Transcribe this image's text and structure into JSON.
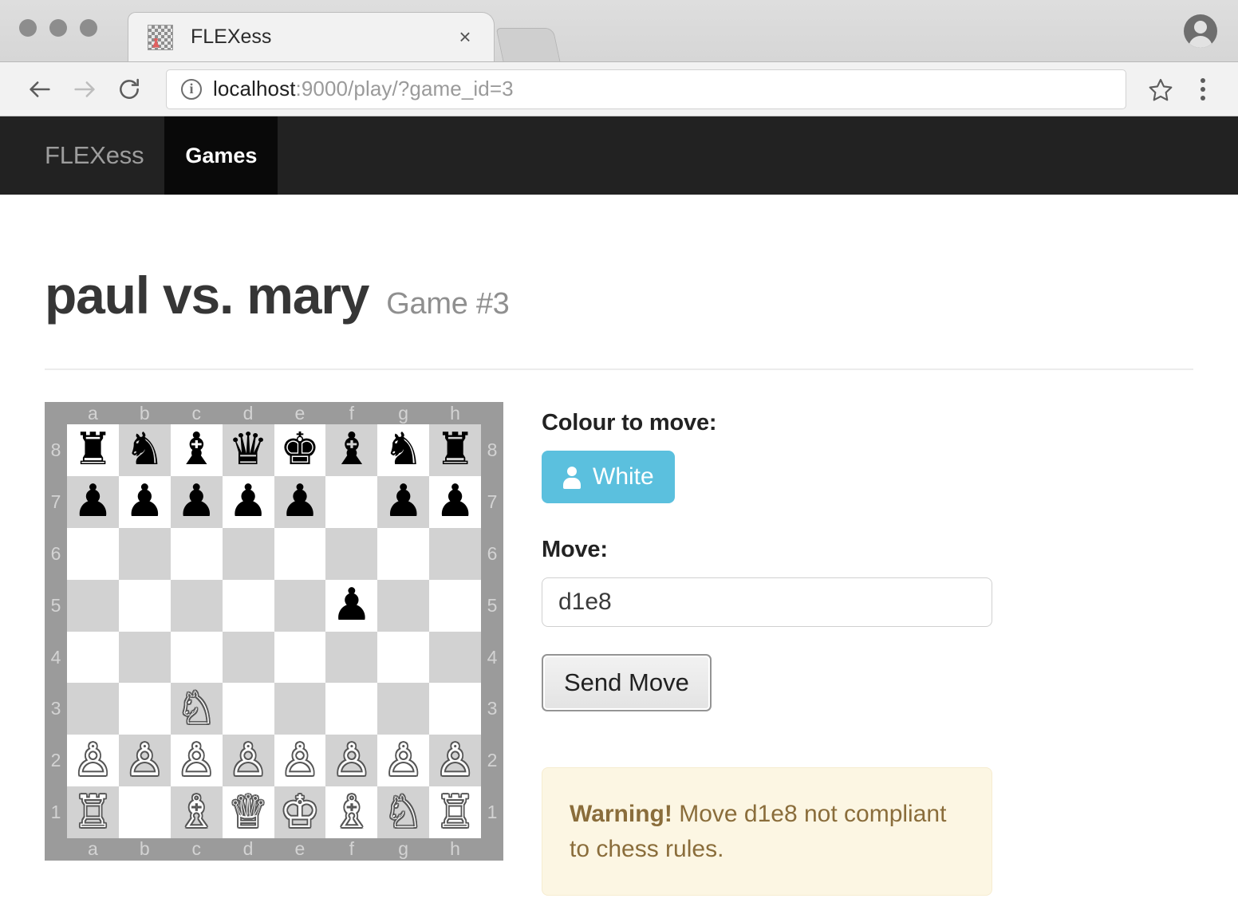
{
  "browser": {
    "tab": {
      "title": "FLEXess",
      "favicon_name": "chessboard-favicon",
      "close_label": "×"
    },
    "url": {
      "host": "localhost",
      "rest": ":9000/play/?game_id=3"
    },
    "back_label": "Back",
    "forward_label": "Forward",
    "reload_label": "Reload",
    "bookmark_label": "Bookmark this page",
    "menu_label": "Customize and control",
    "profile_label": "Profile"
  },
  "navbar": {
    "brand": "FLEXess",
    "links": [
      {
        "label": "Games",
        "active": true
      }
    ]
  },
  "page": {
    "title": "paul vs. mary",
    "subtitle": "Game #3"
  },
  "board": {
    "files": [
      "a",
      "b",
      "c",
      "d",
      "e",
      "f",
      "g",
      "h"
    ],
    "ranks": [
      "8",
      "7",
      "6",
      "5",
      "4",
      "3",
      "2",
      "1"
    ],
    "colors": {
      "light": "#ffffff",
      "dark": "#d2d2d2",
      "border": "#9b9b9b",
      "coord": "#d3d3d3"
    },
    "position_fen": "rnbqkbnr/ppppp1pp/8/5p2/8/2N5/PPPPPPPP/R1BQKBNR",
    "rows": [
      [
        "r",
        "n",
        "b",
        "q",
        "k",
        "b",
        "n",
        "r"
      ],
      [
        "p",
        "p",
        "p",
        "p",
        "p",
        "",
        "p",
        "p"
      ],
      [
        "",
        "",
        "",
        "",
        "",
        "",
        "",
        ""
      ],
      [
        "",
        "",
        "",
        "",
        "",
        "p",
        "",
        ""
      ],
      [
        "",
        "",
        "",
        "",
        "",
        "",
        "",
        ""
      ],
      [
        "",
        "",
        "N",
        "",
        "",
        "",
        "",
        ""
      ],
      [
        "P",
        "P",
        "P",
        "P",
        "P",
        "P",
        "P",
        "P"
      ],
      [
        "R",
        "",
        "B",
        "Q",
        "K",
        "B",
        "N",
        "R"
      ]
    ],
    "glyphs": {
      "K": "♔",
      "Q": "♕",
      "R": "♖",
      "B": "♗",
      "N": "♘",
      "P": "♙",
      "k": "♚",
      "q": "♛",
      "r": "♜",
      "b": "♝",
      "n": "♞",
      "p": "♟"
    }
  },
  "panel": {
    "colour_label": "Colour to move:",
    "colour_value": "White",
    "colour_icon": "person-icon",
    "colour_accent": "#5bc0de",
    "move_label": "Move:",
    "move_value": "d1e8",
    "move_placeholder": "",
    "send_label": "Send Move",
    "warning": {
      "strong": "Warning!",
      "text": " Move d1e8 not compliant to chess rules.",
      "bg": "#fcf6e3",
      "fg": "#8a6d3b"
    }
  }
}
